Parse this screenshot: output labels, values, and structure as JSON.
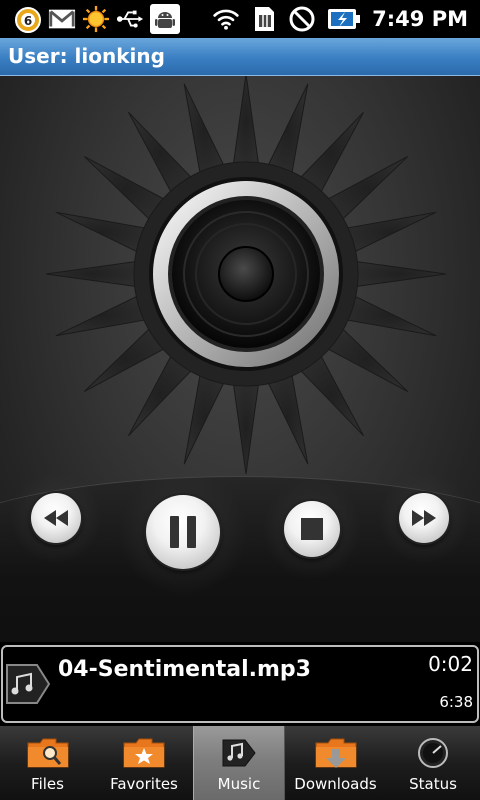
{
  "status_bar": {
    "notification_count": "6",
    "time": "7:49 PM",
    "icons": [
      "notification-count-icon",
      "gmail-icon",
      "weather-sun-icon",
      "usb-icon",
      "android-debug-icon",
      "wifi-icon",
      "sim-icon",
      "do-not-disturb-icon",
      "battery-charging-icon"
    ]
  },
  "title_bar": {
    "title": "User: lionking"
  },
  "player": {
    "controls": [
      "rewind",
      "pause",
      "stop",
      "fast-forward"
    ]
  },
  "track": {
    "title": "04-Sentimental.mp3",
    "elapsed": "0:02",
    "total": "6:38"
  },
  "tabs": [
    {
      "label": "Files",
      "icon": "folder-search-icon"
    },
    {
      "label": "Favorites",
      "icon": "folder-star-icon"
    },
    {
      "label": "Music",
      "icon": "music-tag-icon",
      "active": true
    },
    {
      "label": "Downloads",
      "icon": "folder-download-icon"
    },
    {
      "label": "Status",
      "icon": "gauge-icon"
    }
  ],
  "colors": {
    "title_bar": "#3a7fc3",
    "folder_orange": "#e8761c",
    "active_tab": "#8a8a8a"
  }
}
